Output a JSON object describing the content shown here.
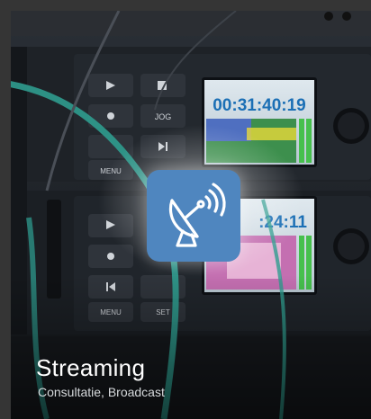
{
  "card": {
    "title": "Streaming",
    "subtitle": "Consultatie, Broadcast",
    "icon": "satellite-dish-icon",
    "accent_color": "#4f86bf"
  },
  "device_top": {
    "timecode": "00:31:40:19",
    "buttons": [
      "JOG",
      "MENU"
    ]
  },
  "device_bottom": {
    "timecode": ":24:11",
    "buttons": [
      "MENU",
      "SET"
    ]
  }
}
